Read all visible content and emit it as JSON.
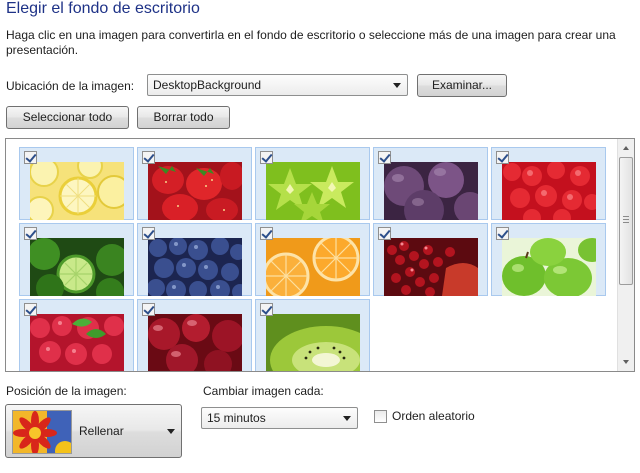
{
  "title": "Elegir el fondo de escritorio",
  "description": "Haga clic en una imagen para convertirla en el fondo de escritorio o seleccione más de una imagen para crear una presentación.",
  "location": {
    "label": "Ubicación de la imagen:",
    "value": "DesktopBackground",
    "browse_label": "Examinar..."
  },
  "toolbar": {
    "select_all_label": "Seleccionar todo",
    "clear_all_label": "Borrar todo"
  },
  "gallery": {
    "items": [
      {
        "subject": "lemon-slices",
        "checked": true
      },
      {
        "subject": "strawberries",
        "checked": true
      },
      {
        "subject": "star-fruit",
        "checked": true
      },
      {
        "subject": "figs",
        "checked": true
      },
      {
        "subject": "raspberries",
        "checked": true
      },
      {
        "subject": "limes",
        "checked": true
      },
      {
        "subject": "blueberries",
        "checked": true
      },
      {
        "subject": "orange-slices",
        "checked": true
      },
      {
        "subject": "pomegranate",
        "checked": true
      },
      {
        "subject": "green-apples",
        "checked": true
      },
      {
        "subject": "raspberries-mint",
        "checked": true
      },
      {
        "subject": "cherries",
        "checked": true
      },
      {
        "subject": "kiwi-slices",
        "checked": true
      }
    ]
  },
  "position": {
    "label": "Posición de la imagen:",
    "value": "Rellenar"
  },
  "interval": {
    "label": "Cambiar imagen cada:",
    "value": "15 minutos"
  },
  "shuffle": {
    "label": "Orden aleatorio",
    "checked": false
  },
  "colors": {
    "title": "#1e3287",
    "tile_bg": "#dbe9f7",
    "tile_border": "#a9c9ee"
  }
}
